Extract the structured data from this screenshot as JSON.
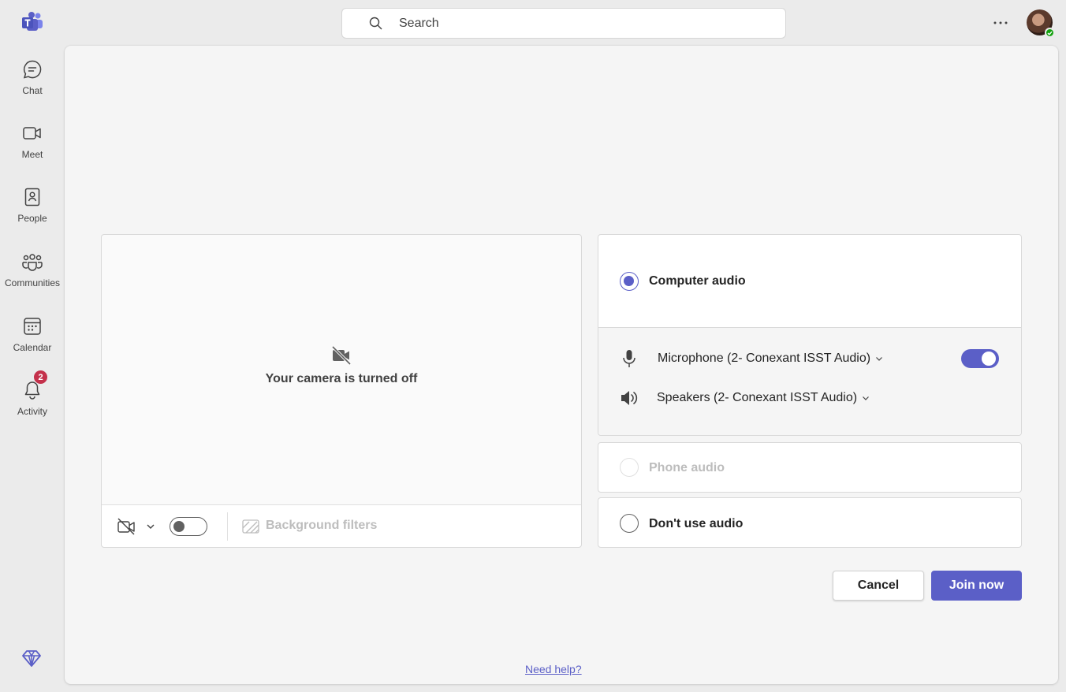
{
  "search": {
    "placeholder": "Search"
  },
  "rail": {
    "items": [
      {
        "label": "Chat"
      },
      {
        "label": "Meet"
      },
      {
        "label": "People"
      },
      {
        "label": "Communities"
      },
      {
        "label": "Calendar"
      },
      {
        "label": "Activity",
        "badge": "2"
      }
    ]
  },
  "video": {
    "camera_off_text": "Your camera is turned off",
    "background_filters_label": "Background filters",
    "camera_toggle_on": false
  },
  "audio": {
    "computer_audio_label": "Computer audio",
    "computer_audio_selected": true,
    "microphone_label": "Microphone (2- Conexant ISST Audio)",
    "microphone_on": true,
    "speakers_label": "Speakers (2- Conexant ISST Audio)",
    "phone_audio_label": "Phone audio",
    "no_audio_label": "Don't use audio"
  },
  "actions": {
    "cancel_label": "Cancel",
    "join_label": "Join now"
  },
  "help_link": "Need help?",
  "colors": {
    "accent": "#5b5fc7",
    "badge": "#c4314b",
    "presence": "#13a10e"
  }
}
